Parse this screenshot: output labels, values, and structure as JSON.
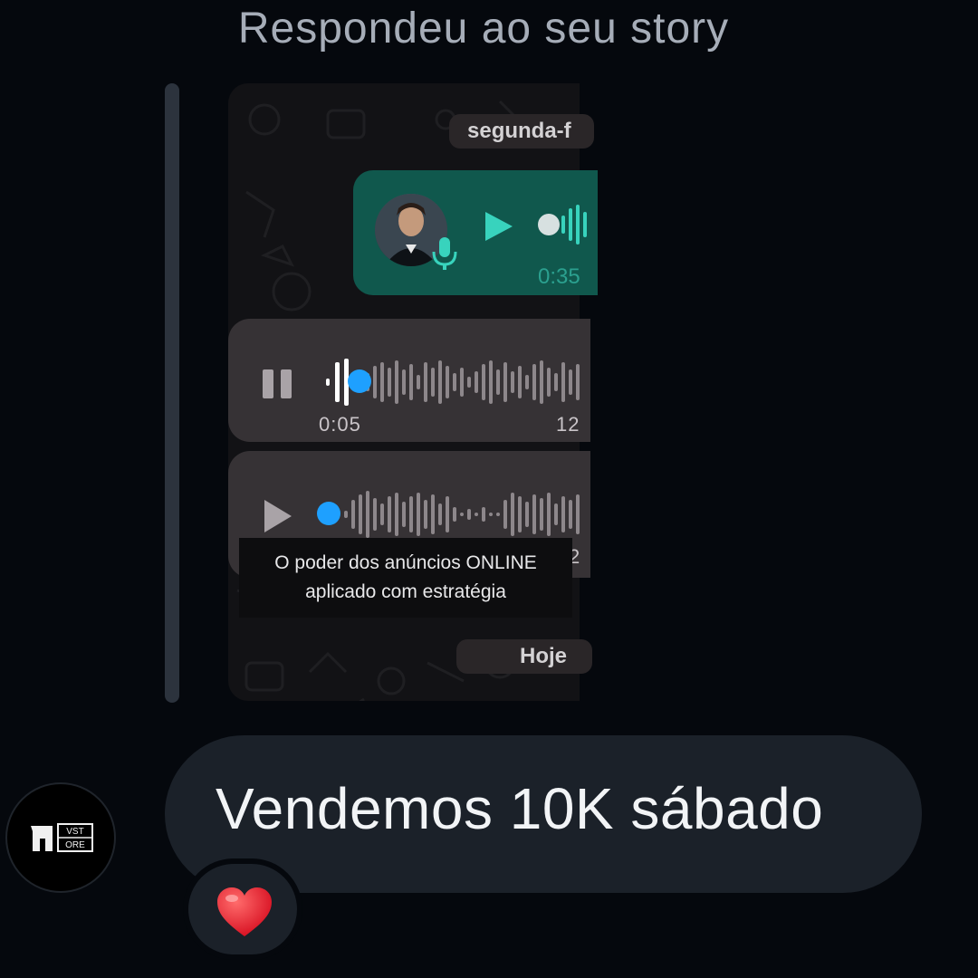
{
  "header": {
    "title": "Respondeu ao seu story"
  },
  "story": {
    "date_label": "segunda-f",
    "green_audio": {
      "time": "0:35"
    },
    "audio_1": {
      "time_start": "0:05",
      "time_end": "12"
    },
    "audio_2": {
      "time_end": "2"
    },
    "caption": {
      "line1": "O poder dos anúncios ONLINE",
      "line2": "aplicado com estratégia"
    },
    "today_label": "Hoje"
  },
  "message": {
    "text": "Vendemos 10K sábado",
    "reaction": "❤️"
  },
  "profile": {
    "logo_text_top": "VST",
    "logo_text_bottom": "ORE"
  },
  "colors": {
    "accent_blue": "#1ea0ff",
    "whatsapp_green": "#10584d",
    "bubble": "#1b2129"
  }
}
